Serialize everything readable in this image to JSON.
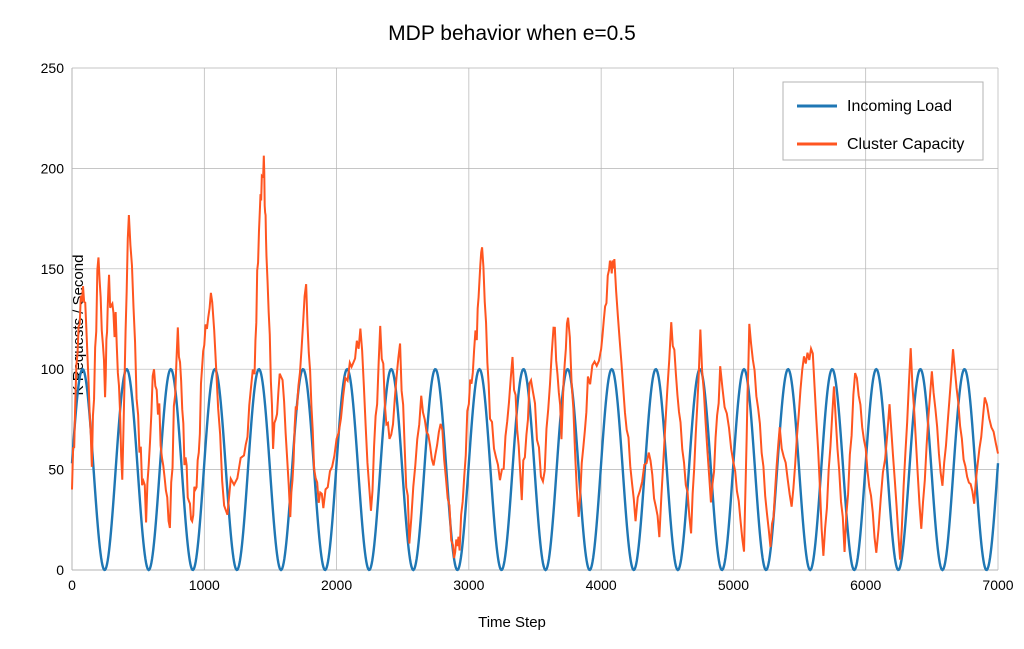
{
  "chart_data": {
    "type": "line",
    "title": "MDP behavior when e=0.5",
    "xlabel": "Time Step",
    "ylabel": "K Requests / Second",
    "xlim": [
      0,
      7000
    ],
    "ylim": [
      0,
      250
    ],
    "x_ticks": [
      0,
      1000,
      2000,
      3000,
      4000,
      5000,
      6000,
      7000
    ],
    "y_ticks": [
      0,
      50,
      100,
      150,
      200,
      250
    ],
    "grid": true,
    "legend_position": "top-right",
    "series": [
      {
        "name": "Incoming Load",
        "color": "#1f77b4",
        "description": "Sinusoidal wave oscillating between 0 and 100 with period ~333 time steps (21 full cycles across 0–7000).",
        "amplitude": 50,
        "offset": 50,
        "period": 333.33,
        "ymin": 0,
        "ymax": 100
      },
      {
        "name": "Cluster Capacity",
        "color": "#ff5520",
        "x": [
          0,
          50,
          100,
          150,
          200,
          250,
          280,
          330,
          380,
          430,
          500,
          560,
          620,
          680,
          740,
          800,
          850,
          900,
          950,
          1000,
          1060,
          1150,
          1300,
          1380,
          1420,
          1450,
          1470,
          1520,
          1580,
          1650,
          1700,
          1770,
          1830,
          1900,
          2000,
          2100,
          2180,
          2260,
          2330,
          2400,
          2480,
          2550,
          2640,
          2720,
          2800,
          2880,
          2930,
          3000,
          3060,
          3100,
          3160,
          3250,
          3330,
          3400,
          3470,
          3560,
          3640,
          3700,
          3750,
          3830,
          3900,
          4000,
          4060,
          4100,
          4180,
          4260,
          4360,
          4440,
          4530,
          4600,
          4680,
          4750,
          4830,
          4900,
          5000,
          5080,
          5120,
          5200,
          5280,
          5350,
          5440,
          5520,
          5600,
          5680,
          5760,
          5840,
          5920,
          6000,
          6080,
          6180,
          6260,
          6340,
          6420,
          6500,
          6580,
          6660,
          6740,
          6820,
          6900,
          7000
        ],
        "values": [
          40,
          125,
          140,
          60,
          160,
          90,
          140,
          120,
          50,
          180,
          70,
          28,
          105,
          60,
          22,
          125,
          60,
          23,
          50,
          120,
          140,
          30,
          55,
          100,
          185,
          200,
          160,
          60,
          100,
          30,
          85,
          140,
          48,
          30,
          70,
          100,
          118,
          25,
          115,
          60,
          107,
          16,
          90,
          55,
          70,
          10,
          15,
          85,
          120,
          165,
          75,
          45,
          106,
          40,
          100,
          40,
          125,
          70,
          130,
          25,
          95,
          110,
          148,
          155,
          80,
          28,
          60,
          18,
          125,
          70,
          20,
          118,
          30,
          98,
          55,
          10,
          124,
          70,
          10,
          70,
          30,
          103,
          110,
          5,
          90,
          10,
          100,
          60,
          10,
          82,
          5,
          108,
          20,
          100,
          40,
          110,
          55,
          35,
          85,
          58
        ]
      }
    ]
  },
  "legend": {
    "items": [
      {
        "label": "Incoming Load",
        "color": "#1f77b4"
      },
      {
        "label": "Cluster Capacity",
        "color": "#ff5520"
      }
    ]
  }
}
